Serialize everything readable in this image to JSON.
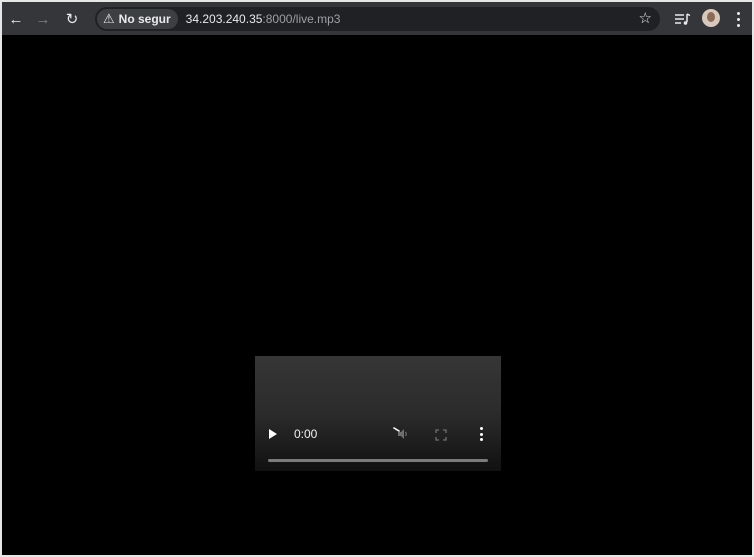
{
  "browser": {
    "security_chip": {
      "icon": "warning-triangle-icon",
      "label": "No segur"
    },
    "url": {
      "host": "34.203.240.35",
      "path": ":8000/live.mp3"
    }
  },
  "player": {
    "time": "0:00",
    "progress": 0,
    "muted": true,
    "state": "paused"
  },
  "colors": {
    "toolbar": "#35363a",
    "omnibox": "#202124",
    "page_background": "#000000",
    "player_surface": "#2b2b2b"
  }
}
